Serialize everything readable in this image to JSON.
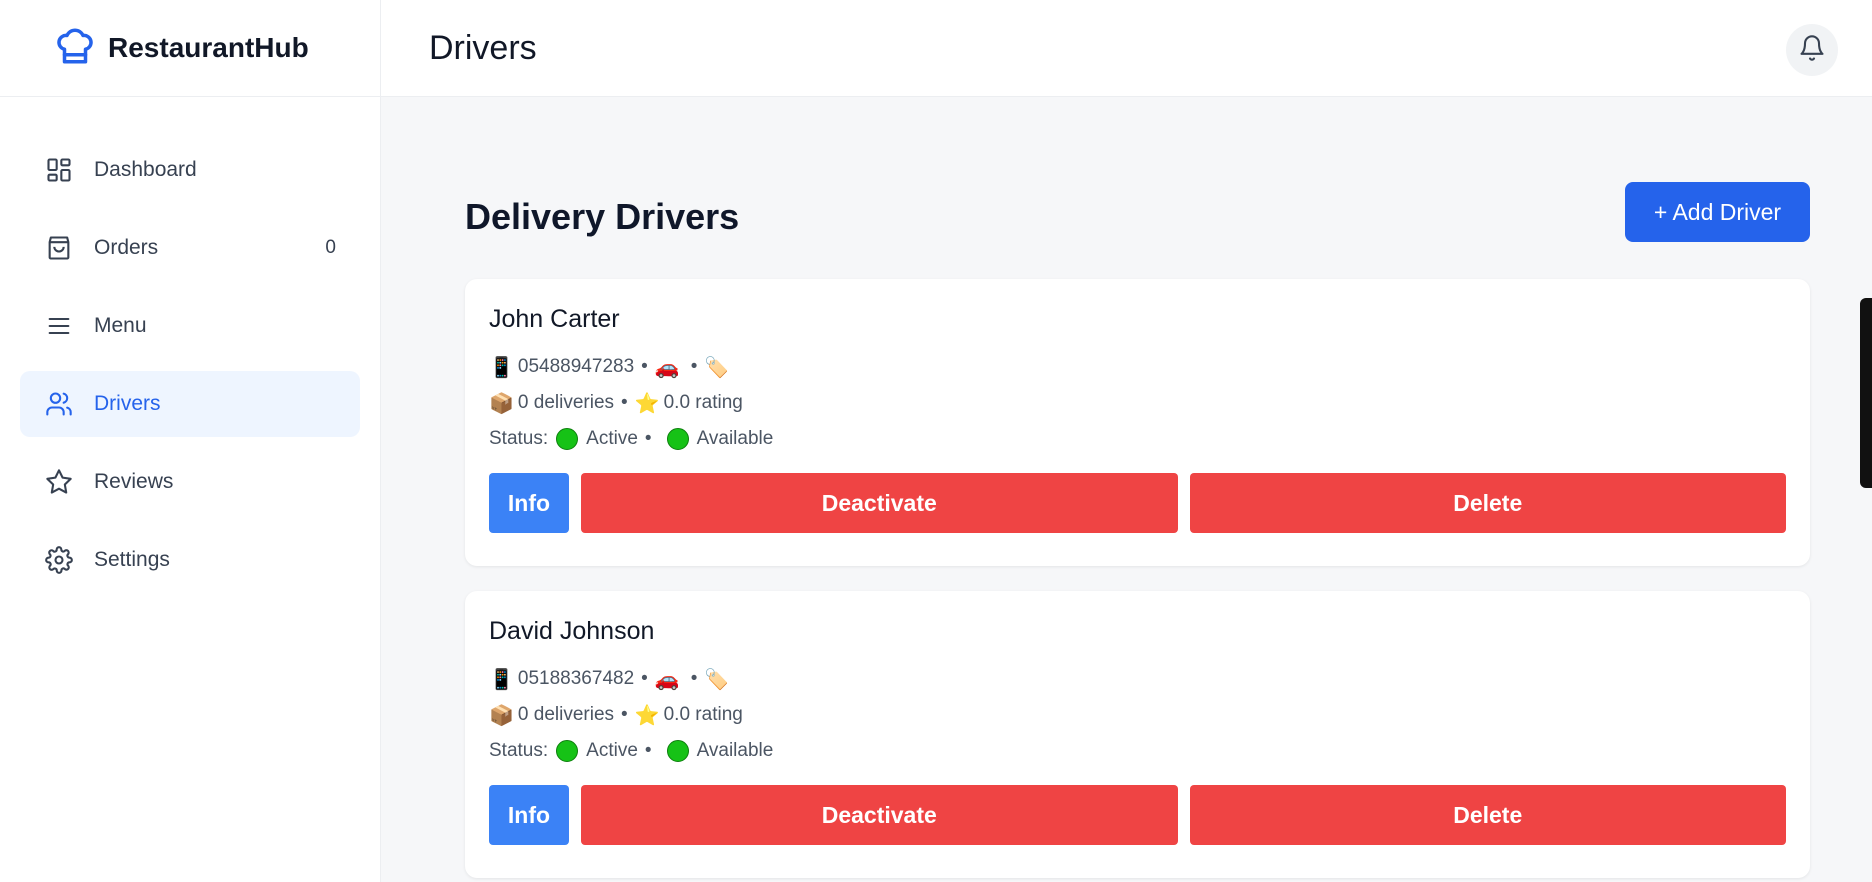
{
  "brand": {
    "name": "RestaurantHub",
    "accent": "#2563eb"
  },
  "sidebar": {
    "items": [
      {
        "label": "Dashboard",
        "icon": "grid-icon",
        "count": ""
      },
      {
        "label": "Orders",
        "icon": "shopping-bag-icon",
        "count": "0"
      },
      {
        "label": "Menu",
        "icon": "menu-icon",
        "count": ""
      },
      {
        "label": "Drivers",
        "icon": "users-icon",
        "count": "",
        "active": true
      },
      {
        "label": "Reviews",
        "icon": "star-icon",
        "count": ""
      },
      {
        "label": "Settings",
        "icon": "gear-icon",
        "count": ""
      }
    ]
  },
  "header": {
    "title": "Drivers",
    "notification_icon": "bell-icon"
  },
  "main": {
    "heading": "Delivery Drivers",
    "add_button": "+ Add Driver",
    "status_prefix": "Status:",
    "deliveries_suffix": "deliveries",
    "rating_suffix": "rating",
    "drivers": [
      {
        "name": "John Carter",
        "phone": "05488947283",
        "deliveries": "0",
        "rating": "0.0",
        "status": "Active",
        "availability": "Available",
        "info_label": "Info",
        "deactivate_label": "Deactivate",
        "delete_label": "Delete"
      },
      {
        "name": "David Johnson",
        "phone": "05188367482",
        "deliveries": "0",
        "rating": "0.0",
        "status": "Active",
        "availability": "Available",
        "info_label": "Info",
        "deactivate_label": "Deactivate",
        "delete_label": "Delete"
      }
    ]
  },
  "colors": {
    "primary": "#2563eb",
    "info": "#3b82f6",
    "danger": "#ef4444",
    "status_green": "#16c216"
  }
}
